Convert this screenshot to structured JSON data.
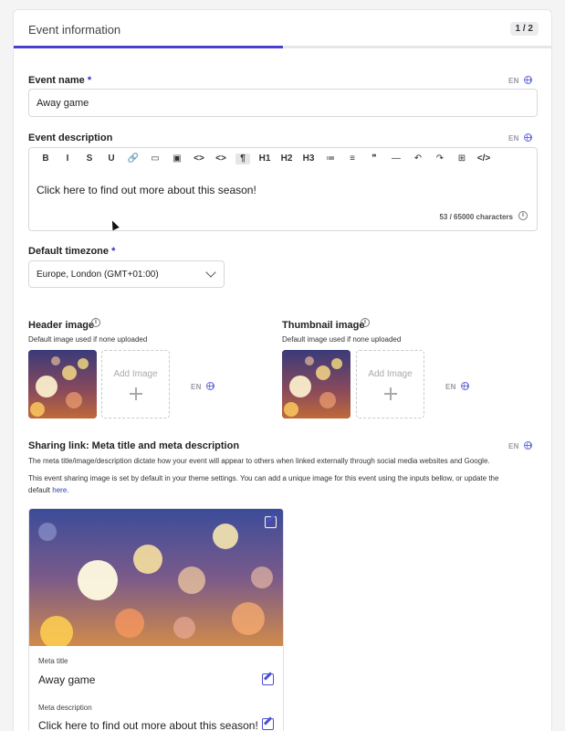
{
  "header": {
    "title": "Event information",
    "step": "1 / 2",
    "progress": 0.5
  },
  "lang": "EN",
  "event_name": {
    "label": "Event name",
    "required": "*",
    "value": "Away game"
  },
  "event_description": {
    "label": "Event description",
    "toolbar": [
      "B",
      "I",
      "S",
      "U",
      "link",
      "image",
      "video",
      "<>",
      "<>",
      "¶",
      "H1",
      "H2",
      "H3",
      "bullet-list",
      "numbered-list",
      "quote",
      "—",
      "undo",
      "redo",
      "table",
      "</>"
    ],
    "text": "Click here to find out more about this season!",
    "count": "53 / 65000 characters"
  },
  "timezone": {
    "label": "Default timezone",
    "required": "*",
    "value": "Europe, London (GMT+01:00)"
  },
  "header_image": {
    "label": "Header image",
    "sub": "Default image used if none uploaded",
    "add": "Add Image"
  },
  "thumbnail_image": {
    "label": "Thumbnail image",
    "sub": "Default image used if none uploaded",
    "add": "Add Image"
  },
  "sharing": {
    "title": "Sharing link: Meta title and meta description",
    "p1": "The meta title/image/description dictate how your event will appear to others when linked externally through social media websites and Google.",
    "p2": "This event sharing image is set by default in your theme settings. You can add a unique image for this event using the inputs bellow, or update the",
    "p3": "default",
    "link": "here",
    "dot": ".",
    "meta_title_label": "Meta title",
    "meta_title": "Away game",
    "meta_desc_label": "Meta description",
    "meta_desc": "Click here to find out more about this season!"
  }
}
